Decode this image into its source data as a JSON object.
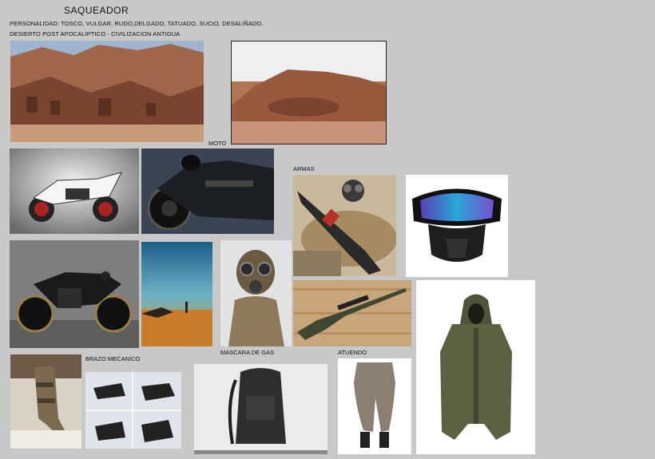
{
  "header": {
    "title": "SAQUEADOR",
    "personality": "PERSONALIDAD: TOSCO, VULGAR, RUDO,DELGADO, TATUADO, SUCIO, DESALIÑADO.",
    "setting": "DESIERTO POST APOCALIPTICO - CIVILIZACION ANTIGUA"
  },
  "labels": {
    "moto": "MOTO",
    "armas": "ARMAS",
    "brazo": "BRAZO MECANICO",
    "mascara": "MASCARA DE GAS",
    "atuendo": "ATUENDO"
  },
  "images": [
    {
      "icon": "canyon-ruins-photo-icon"
    },
    {
      "icon": "desert-rock-photo-icon"
    },
    {
      "icon": "white-motorcycle-photo-icon"
    },
    {
      "icon": "black-motorcycle-photo-icon"
    },
    {
      "icon": "shotgun-gasmask-photo-icon"
    },
    {
      "icon": "goggles-mask-photo-icon"
    },
    {
      "icon": "cafe-racer-photo-icon"
    },
    {
      "icon": "wasteland-poster-icon"
    },
    {
      "icon": "masked-figure-photo-icon"
    },
    {
      "icon": "sniper-rifle-photo-icon"
    },
    {
      "icon": "hooded-coat-photo-icon"
    },
    {
      "icon": "mechanical-arm-photo-icon"
    },
    {
      "icon": "robotic-gloves-photo-icon"
    },
    {
      "icon": "backpack-photo-icon"
    },
    {
      "icon": "baggy-pants-photo-icon"
    }
  ]
}
